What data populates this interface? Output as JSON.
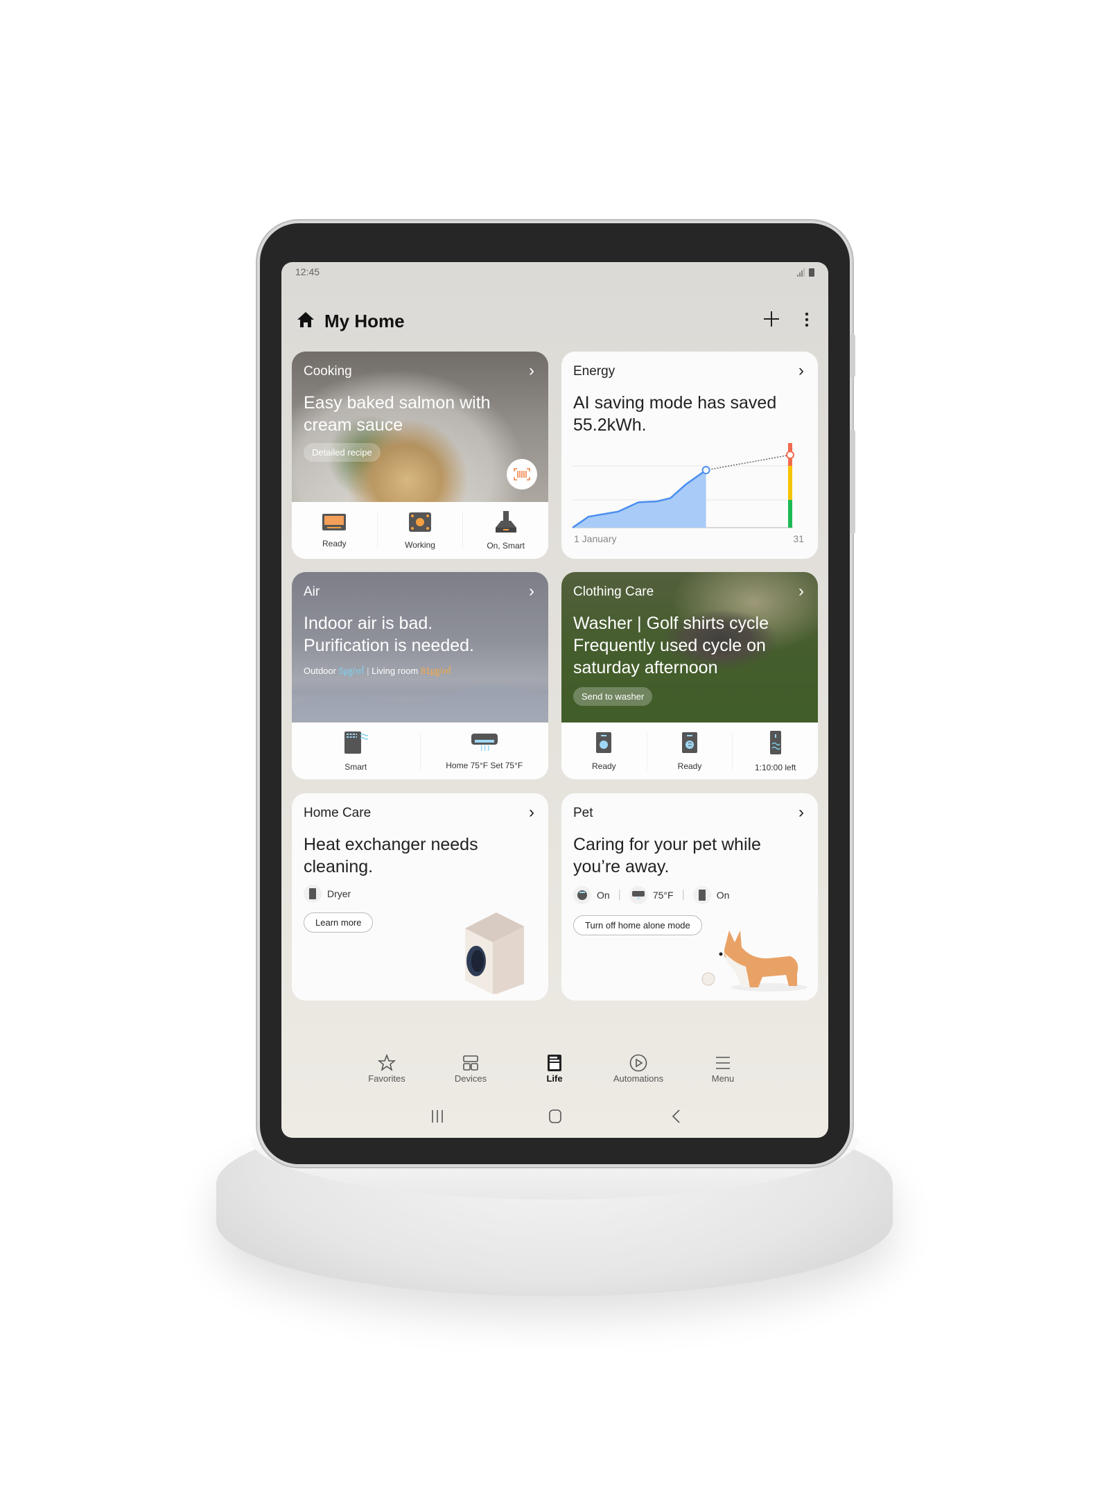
{
  "status": {
    "time": "12:45",
    "icons": [
      "signal-icon",
      "battery-icon"
    ]
  },
  "header": {
    "title": "My Home",
    "icon": "home-icon",
    "add_icon": "plus-icon",
    "more_icon": "more-vert-icon"
  },
  "cards": {
    "cooking": {
      "category": "Cooking",
      "title_line1": "Easy baked salmon with",
      "title_line2": "cream sauce",
      "button": "Detailed recipe",
      "scan_icon": "barcode-icon",
      "devices": [
        {
          "label": "Ready",
          "icon": "oven-icon"
        },
        {
          "label": "Working",
          "icon": "cooktop-icon"
        },
        {
          "label": "On, Smart",
          "icon": "range-hood-icon"
        }
      ]
    },
    "energy": {
      "category": "Energy",
      "title_line1": "AI saving mode has saved",
      "title_line2": "55.2kWh.",
      "x_start": "1 January",
      "x_end": "31",
      "chart": {
        "type": "area",
        "x": [
          1,
          2.2,
          3.2,
          7.3,
          10.1,
          12.6,
          14.5,
          16.6,
          19.4
        ],
        "y": [
          0,
          7,
          13,
          19,
          30,
          31,
          35,
          51,
          68
        ],
        "projection": {
          "x": 31,
          "y": 86
        },
        "ylim": [
          0,
          100
        ],
        "xlim": [
          1,
          31
        ],
        "gridlines": [
          33,
          73
        ],
        "level_bands": [
          {
            "from": 0,
            "to": 33,
            "color": "#1db954"
          },
          {
            "from": 33,
            "to": 73,
            "color": "#f5c400"
          },
          {
            "from": 73,
            "to": 100,
            "color": "#f26b4f"
          }
        ],
        "fill_color": "#a9cbf7",
        "line_color": "#4b8ef0"
      }
    },
    "air": {
      "category": "Air",
      "title_line1": "Indoor air is bad.",
      "title_line2": "Purification is needed.",
      "outdoor_label": "Outdoor",
      "outdoor_value": "5㎍/㎥",
      "outdoor_color": "#7fd0f0",
      "room_label": "Living room",
      "room_value": "81㎍/㎥",
      "room_color": "#f5a94a",
      "devices": [
        {
          "label": "Smart",
          "icon": "air-purifier-icon"
        },
        {
          "label": "Home 75°F Set 75°F",
          "icon": "air-conditioner-icon"
        }
      ]
    },
    "clothing": {
      "category": "Clothing Care",
      "title_line1": "Washer | Golf shirts cycle",
      "title_line2": "Frequently used cycle on",
      "title_line3": "saturday afternoon",
      "button": "Send to washer",
      "devices": [
        {
          "label": "Ready",
          "icon": "washer-icon"
        },
        {
          "label": "Ready",
          "icon": "dryer-icon"
        },
        {
          "label": "1:10:00 left",
          "icon": "styler-icon"
        }
      ]
    },
    "homecare": {
      "category": "Home Care",
      "title_line1": "Heat exchanger needs",
      "title_line2": "cleaning.",
      "device": "Dryer",
      "button": "Learn more"
    },
    "pet": {
      "category": "Pet",
      "title_line1": "Caring for your pet while",
      "title_line2": "you’re away.",
      "statuses": [
        {
          "label": "On",
          "icon": "robot-vacuum-icon"
        },
        {
          "label": "75°F",
          "icon": "air-conditioner-icon"
        },
        {
          "label": "On",
          "icon": "air-purifier-icon"
        }
      ],
      "button": "Turn off home alone mode"
    }
  },
  "bottom_nav": [
    {
      "label": "Favorites",
      "icon": "star-icon"
    },
    {
      "label": "Devices",
      "icon": "devices-icon"
    },
    {
      "label": "Life",
      "icon": "life-icon",
      "active": true
    },
    {
      "label": "Automations",
      "icon": "play-circle-icon"
    },
    {
      "label": "Menu",
      "icon": "menu-icon"
    }
  ],
  "system_nav": [
    "recents-icon",
    "home-button-icon",
    "back-icon"
  ]
}
